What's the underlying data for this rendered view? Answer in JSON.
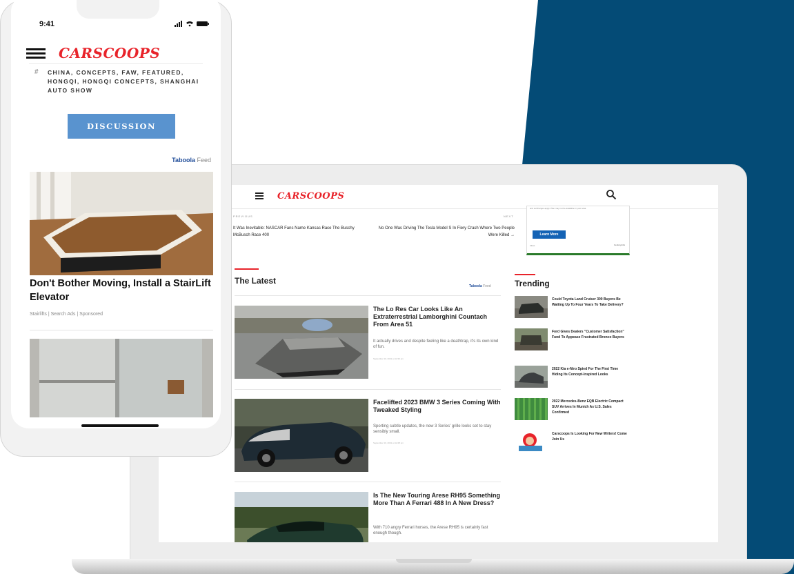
{
  "colors": {
    "brand_blue": "#044b76",
    "brand_red": "#e8232a",
    "discussion_blue": "#5993cf",
    "learn_more_blue": "#1463b5"
  },
  "laptop": {
    "logo": "CARSCOOPS",
    "icons": {
      "menu": "hamburger-menu-icon",
      "search": "search-icon"
    },
    "nav": {
      "prev_label": "PREVIOUS",
      "prev_title": "It Was Inevitable: NASCAR Fans Name Kansas Race The Buschy McBusch Race 400",
      "next_label": "NEXT",
      "next_title": "No One Was Driving The Tesla Model S In Fiery Crash Where Two People Were Killed →"
    },
    "ad": {
      "fine_print": "and surcharges apply. Plan may not be available in your area.",
      "button": "Learn More",
      "caption": "Ideas",
      "brand": "CenturyLink"
    },
    "latest": {
      "heading": "The Latest",
      "feed_brand": "Taboola",
      "feed_label": "Feed",
      "articles": [
        {
          "title": "The Lo Res Car Looks Like An Extraterrestrial Lamborghini Countach From Area 51",
          "desc": "It actually drives and despite feeling like a deathtrap, it's its own kind of fun.",
          "date": "September 10, 2021 at 12:33 pm"
        },
        {
          "title": "Facelifted 2023 BMW 3 Series Coming With Tweaked Styling",
          "desc": "Sporting subtle updates, the new 3 Series' grille looks set to stay sensibly small.",
          "date": "September 10, 2021 at 12:28 pm"
        },
        {
          "title": "Is The New Touring Arese RH95 Something More Than A Ferrari 488 In A New Dress?",
          "desc": "With 710 angry Ferrari horses, the Arese RH95 is certainly fast enough though.",
          "date": ""
        }
      ]
    },
    "trending": {
      "heading": "Trending",
      "items": [
        {
          "title": "Could Toyota Land Cruiser 300 Buyers Be Waiting Up To Four Years To Take Delivery?"
        },
        {
          "title": "Ford Gives Dealers \"Customer Satisfaction\" Fund To Appease Frustrated Bronco Buyers"
        },
        {
          "title": "2022 Kia e-Niro Spied For The First Time Hiding Its Concept-Inspired Looks"
        },
        {
          "title": "2022 Mercedes-Benz EQB Electric Compact SUV Arrives In Munich As U.S. Sales Confirmed"
        },
        {
          "title": "Carscoops Is Looking For New Writers! Come Join Us"
        }
      ]
    }
  },
  "phone": {
    "time": "9:41",
    "logo": "CARSCOOPS",
    "tags": "CHINA, CONCEPTS, FAW, FEATURED, HONGQI, HONGQI CONCEPTS, SHANGHAI AUTO SHOW",
    "discussion_button": "DISCUSSION",
    "feed_brand": "Taboola",
    "feed_label": "Feed",
    "ad_title": "Don't Bother Moving, Install a StairLift Elevator",
    "ad_sponsor": "Stairlifts | Search Ads | Sponsored"
  }
}
